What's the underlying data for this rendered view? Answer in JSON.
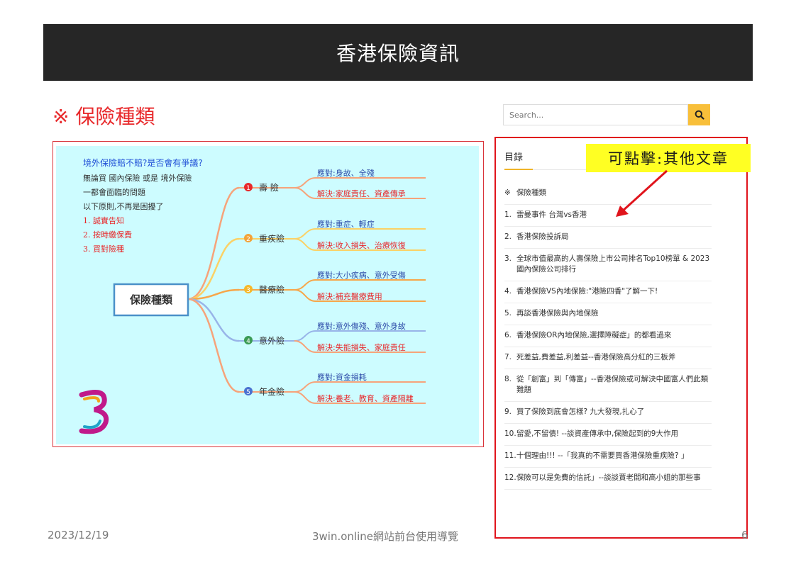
{
  "banner": {
    "title": "香港保險資訊"
  },
  "section": {
    "title": "※ 保險種類"
  },
  "mindmap": {
    "intro": {
      "question": "境外保險賠不賠?是否會有爭議?",
      "lines": [
        "無論買 國內保險 或是 境外保險",
        "一都會面臨的問題",
        "以下原則,不再是困擾了"
      ],
      "principles": [
        "1. 誠實告知",
        "2. 按時繳保費",
        "3. 買對險種"
      ]
    },
    "center": "保險種類",
    "branches": [
      {
        "num": "1",
        "name": "壽 險",
        "cope": "應對:身故、全殘",
        "solve": "解決:家庭責任、資產傳承"
      },
      {
        "num": "2",
        "name": "重疾險",
        "cope": "應對:重症、輕症",
        "solve": "解決:收入損失、治療恢復"
      },
      {
        "num": "3",
        "name": "醫療險",
        "cope": "應對:大小疾病、意外受傷",
        "solve": "解決:補充醫療費用"
      },
      {
        "num": "4",
        "name": "意外險",
        "cope": "應對:意外傷殘、意外身故",
        "solve": "解決:失能損失、家庭責任"
      },
      {
        "num": "5",
        "name": "年金險",
        "cope": "應對:資金損耗",
        "solve": "解決:養老、教育、資產隔離"
      }
    ]
  },
  "search": {
    "placeholder": "Search..."
  },
  "toc": {
    "title": "目錄",
    "items": [
      {
        "num": "※",
        "text": "保險種類"
      },
      {
        "num": "1.",
        "text": "雷曼事件 台灣vs香港"
      },
      {
        "num": "2.",
        "text": "香港保險投訴局"
      },
      {
        "num": "3.",
        "text": "全球市值最高的人壽保險上市公司排名Top10榜單 & 2023國內保險公司排行"
      },
      {
        "num": "4.",
        "text": "香港保險VS內地保險:\"港險四香\"了解一下!"
      },
      {
        "num": "5.",
        "text": "再談香港保險與內地保險"
      },
      {
        "num": "6.",
        "text": "香港保險OR內地保險,選擇障礙症」的都看過來"
      },
      {
        "num": "7.",
        "text": "死差益,費差益,利差益--香港保險高分紅的三板斧"
      },
      {
        "num": "8.",
        "text": "從「創富」到「傳富」--香港保險或可解決中國富人們此類難題"
      },
      {
        "num": "9.",
        "text": "買了保險到底會怎樣? 九大發現,扎心了"
      },
      {
        "num": "10.",
        "text": "留愛,不留債! --談資產傳承中,保險起到的9大作用"
      },
      {
        "num": "11.",
        "text": "十個理由!!! --「我真的不需要買香港保險重疾險? 」"
      },
      {
        "num": "12.",
        "text": "保險可以是免費的信託」--談談賈老闆和高小姐的那些事"
      }
    ]
  },
  "callout": {
    "text": "可點擊:其他文章"
  },
  "footer": {
    "date": "2023/12/19",
    "center": "3win.online網站前台使用導覽",
    "page": "6"
  },
  "colors": {
    "banner": "#262626",
    "accent": "#e8292b",
    "search_button": "#f8bf3a",
    "callout": "#ffff23",
    "mindmap_bg": "#cdfcff"
  },
  "icons": {
    "search": "search-icon",
    "logo": "3win-logo"
  }
}
